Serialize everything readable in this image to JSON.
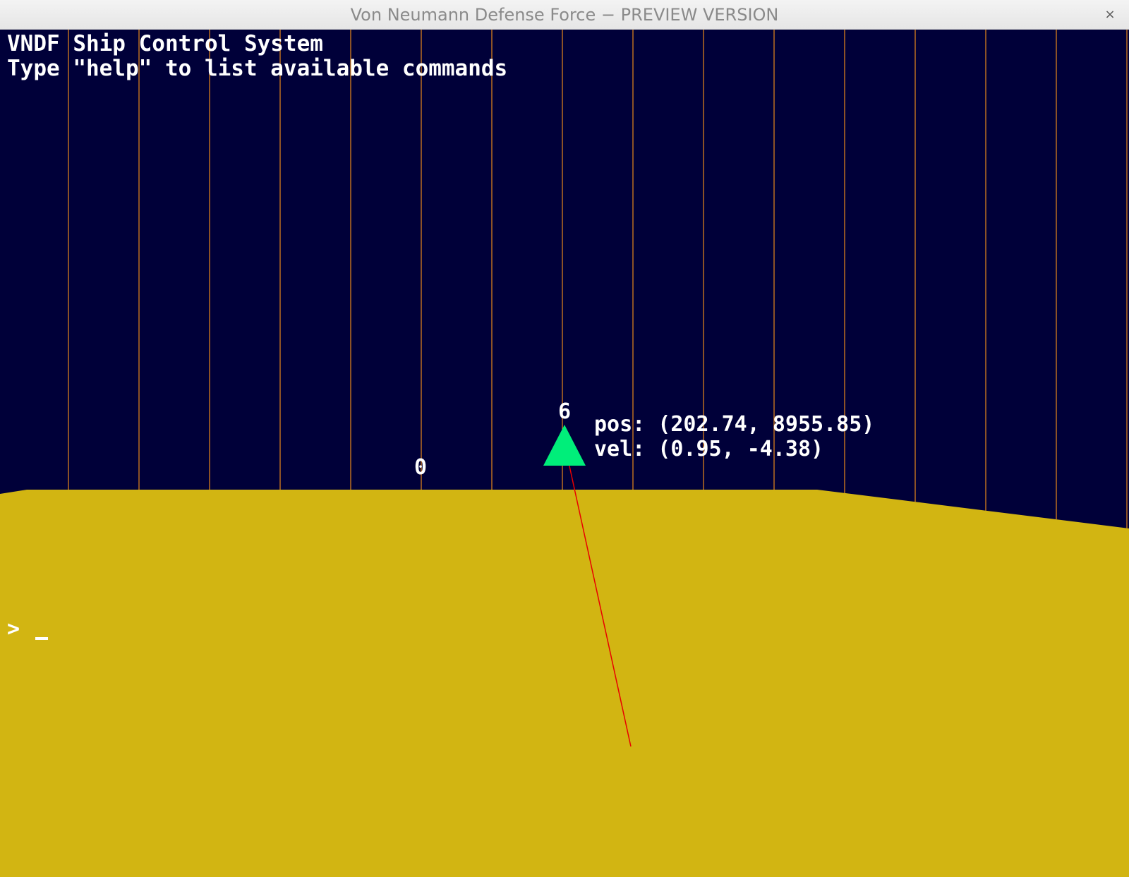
{
  "window": {
    "title": "Von Neumann Defense Force − PREVIEW VERSION",
    "close_symbol": "×"
  },
  "console": {
    "header_lines": [
      "VNDF Ship Control System",
      "Type \"help\" to list available commands"
    ],
    "prompt": "> ",
    "input_value": ""
  },
  "scene": {
    "colors": {
      "sky": "#000039",
      "ground": "#d2b512",
      "grid_line": "#e8891a",
      "ship": "#00ee7a",
      "velocity_vector": "#e80000"
    },
    "grid_markers": [
      {
        "label": "0"
      }
    ],
    "ship": {
      "id": "6",
      "pos_text": "pos: (202.74, 8955.85)",
      "vel_text": "vel: (0.95, -4.38)",
      "icon": "triangle-ship-icon"
    }
  }
}
